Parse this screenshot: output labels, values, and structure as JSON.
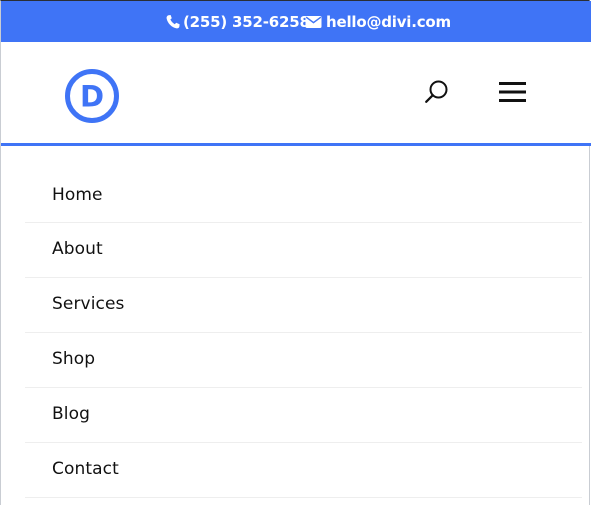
{
  "topbar": {
    "phone_icon": "phone-icon",
    "phone": "(255) 352-6258",
    "email_icon": "envelope-icon",
    "email": "hello@divi.com"
  },
  "header": {
    "logo_letter": "D",
    "logo_icon": "divi-logo",
    "search_icon": "search-icon",
    "menu_icon": "hamburger-menu-icon"
  },
  "menu": {
    "items": [
      {
        "label": "Home"
      },
      {
        "label": "About"
      },
      {
        "label": "Services"
      },
      {
        "label": "Shop"
      },
      {
        "label": "Blog"
      },
      {
        "label": "Contact"
      }
    ]
  },
  "colors": {
    "accent": "#3f74f6",
    "text": "#111111",
    "divider": "#eeeeee"
  }
}
